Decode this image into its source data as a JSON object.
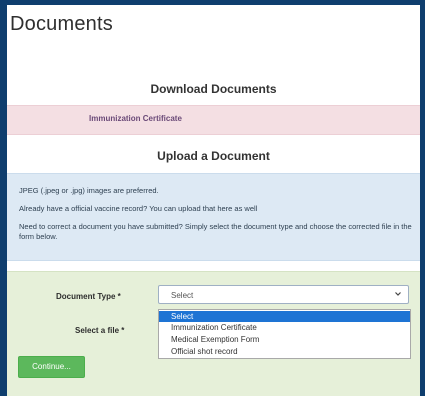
{
  "page": {
    "title": "Documents"
  },
  "download": {
    "heading": "Download Documents",
    "link_label": "Immunization Certificate"
  },
  "upload": {
    "heading": "Upload a Document",
    "info_lines": [
      "JPEG (.jpeg or .jpg) images are preferred.",
      "Already have a official vaccine record? You can upload that here as well",
      "Need to correct a document you have submitted? Simply select the document type and choose the corrected file in the form below."
    ]
  },
  "form": {
    "document_type_label": "Document Type *",
    "select_file_label": "Select a file *",
    "selected_value": "Select",
    "options": [
      "Select",
      "Immunization Certificate",
      "Medical Exemption Form",
      "Official shot record"
    ],
    "continue_label": "Continue..."
  },
  "colors": {
    "page_background": "#0f3e6e",
    "download_bar": "#f4dfe3",
    "info_box": "#dde9f4",
    "form_box": "#e6f0d9",
    "selected_option": "#1e74d4",
    "continue_button": "#5cb85c"
  },
  "icons": {
    "select_chevron": "chevron-down-icon"
  }
}
